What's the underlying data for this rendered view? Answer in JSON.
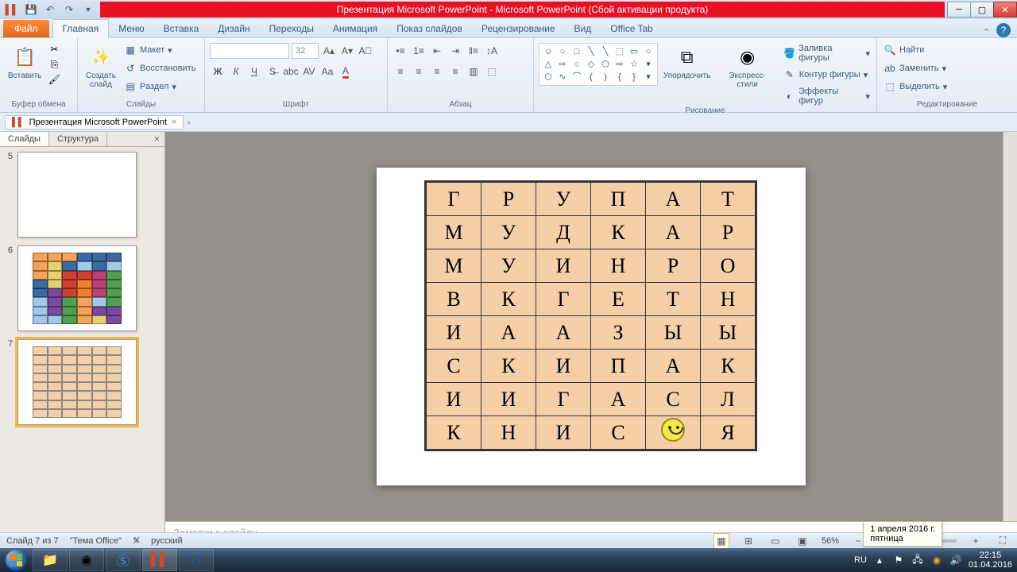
{
  "titlebar": {
    "title": "Презентация Microsoft PowerPoint  -  Microsoft PowerPoint (Сбой активации продукта)"
  },
  "tabs": {
    "file": "Файл",
    "items": [
      "Главная",
      "Меню",
      "Вставка",
      "Дизайн",
      "Переходы",
      "Анимация",
      "Показ слайдов",
      "Рецензирование",
      "Вид",
      "Office Tab"
    ],
    "active": 0
  },
  "ribbon": {
    "clipboard": {
      "label": "Буфер обмена",
      "paste": "Вставить"
    },
    "slides": {
      "label": "Слайды",
      "new_slide": "Создать\nслайд",
      "layout": "Макет",
      "reset": "Восстановить",
      "section": "Раздел"
    },
    "font": {
      "label": "Шрифт",
      "size": "32"
    },
    "paragraph": {
      "label": "Абзац"
    },
    "drawing": {
      "label": "Рисование",
      "arrange": "Упорядочить",
      "quick_styles": "Экспресс-стили",
      "shape_fill": "Заливка фигуры",
      "shape_outline": "Контур фигуры",
      "shape_effects": "Эффекты фигур"
    },
    "editing": {
      "label": "Редактирование",
      "find": "Найти",
      "replace": "Заменить",
      "select": "Выделить"
    }
  },
  "doc_tab": {
    "name": "Презентация Microsoft PowerPoint"
  },
  "side": {
    "tab_slides": "Слайды",
    "tab_outline": "Структура",
    "thumbs": [
      5,
      6,
      7
    ],
    "selected": 7
  },
  "grid": {
    "rows": [
      [
        "Г",
        "Р",
        "У",
        "П",
        "А",
        "Т"
      ],
      [
        "М",
        "У",
        "Д",
        "К",
        "А",
        "Р"
      ],
      [
        "М",
        "У",
        "И",
        "Н",
        "Р",
        "О"
      ],
      [
        "В",
        "К",
        "Г",
        "Е",
        "Т",
        "Н"
      ],
      [
        "И",
        "А",
        "А",
        "З",
        "Ы",
        "Ы"
      ],
      [
        "С",
        "К",
        "И",
        "П",
        "А",
        "К"
      ],
      [
        "И",
        "И",
        "Г",
        "А",
        "С",
        "Л"
      ],
      [
        "К",
        "Н",
        "И",
        "С",
        "☺",
        "Я"
      ]
    ]
  },
  "thumb6_colors": [
    "#f5a35a",
    "#f5a35a",
    "#f5a35a",
    "#3a6aa0",
    "#3a6aa0",
    "#3a6aa0",
    "#f5a35a",
    "#e8d070",
    "#3a6aa0",
    "#a0c8e8",
    "#3a6aa0",
    "#a0c8e8",
    "#f5a35a",
    "#e8d070",
    "#d04030",
    "#d04030",
    "#c04078",
    "#50a050",
    "#3a6aa0",
    "#e8d070",
    "#d04030",
    "#f08030",
    "#c04078",
    "#50a050",
    "#3a6aa0",
    "#7a4aa0",
    "#d04030",
    "#f08030",
    "#c04078",
    "#50a050",
    "#a0c8e8",
    "#7a4aa0",
    "#50a050",
    "#f5a35a",
    "#a0c8e8",
    "#50a050",
    "#a0c8e8",
    "#7a4aa0",
    "#50a050",
    "#f5a35a",
    "#7a4aa0",
    "#7a4aa0",
    "#a0c8e8",
    "#a0c8e8",
    "#50a050",
    "#f5a35a",
    "#e8d070",
    "#7a4aa0"
  ],
  "notes_placeholder": "Заметки к слайду",
  "status": {
    "slide_info": "Слайд 7 из 7",
    "theme": "\"Тема Office\"",
    "language": "русский",
    "zoom": "56%"
  },
  "date_tip": {
    "line1": "1 апреля 2016 г.",
    "line2": "пятница"
  },
  "tray": {
    "lang": "RU",
    "time": "22:15",
    "date": "01.04.2016"
  }
}
